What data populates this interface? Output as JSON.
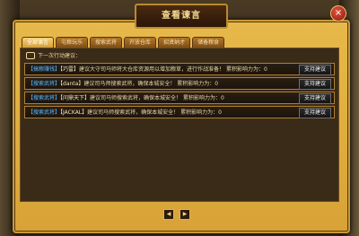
{
  "dialog": {
    "title": "查看谏言",
    "close_label": "×",
    "tabs": [
      {
        "label": "全部谏言",
        "active": true
      },
      {
        "label": "屯粮玩乐",
        "active": false
      },
      {
        "label": "搜索武将",
        "active": false
      },
      {
        "label": "开放仓库",
        "active": false
      },
      {
        "label": "招贤纳才",
        "active": false
      },
      {
        "label": "储备粮食",
        "active": false
      }
    ],
    "hint": "下一次行动建议：",
    "rows": [
      {
        "tag": "【搞粮赚钱】",
        "speaker": "【巧雷】",
        "text": "建议大守司马师将大仓库资源用以增加粮草，进行作战准备！",
        "influence": "累积影响力为：0",
        "button": "支持建议"
      },
      {
        "tag": "【搜索武将】",
        "speaker": "【danta】",
        "text": "建议司马师搜索武将，确保本城安全！",
        "influence": "累积影响力为：0",
        "button": "支持建议"
      },
      {
        "tag": "【搜索武将】",
        "speaker": "【问鼎天下】",
        "text": "建议司马师搜索武将，确保本城安全！",
        "influence": "累积影响力为：0",
        "button": "支持建议"
      },
      {
        "tag": "【搜索武将】",
        "speaker": "【JACKAL】",
        "text": "建议司马师搜索武将，确保本城安全！",
        "influence": "累积影响力为：0",
        "button": "支持建议"
      }
    ],
    "pager": {
      "prev": "◀",
      "next": "▶"
    }
  }
}
